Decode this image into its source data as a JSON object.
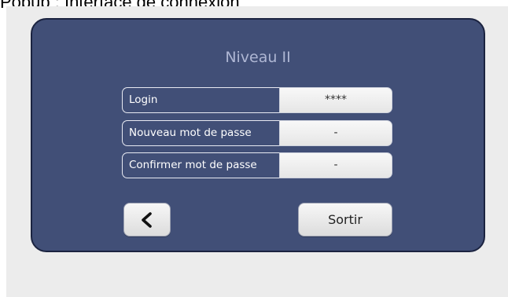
{
  "caption": "Popup : Interface de connexion",
  "popup": {
    "title": "Niveau II",
    "fields": [
      {
        "label": "Login",
        "value": "****"
      },
      {
        "label": "Nouveau mot de passe",
        "value": "-"
      },
      {
        "label": "Confirmer mot de passe",
        "value": "-"
      }
    ],
    "back_button": {
      "icon": "chevron-left-icon"
    },
    "exit_button": {
      "label": "Sortir"
    }
  },
  "colors": {
    "panel": "#414f77",
    "panel_border": "#1b2340",
    "title": "#aeb6d3",
    "canvas": "#ececec"
  }
}
